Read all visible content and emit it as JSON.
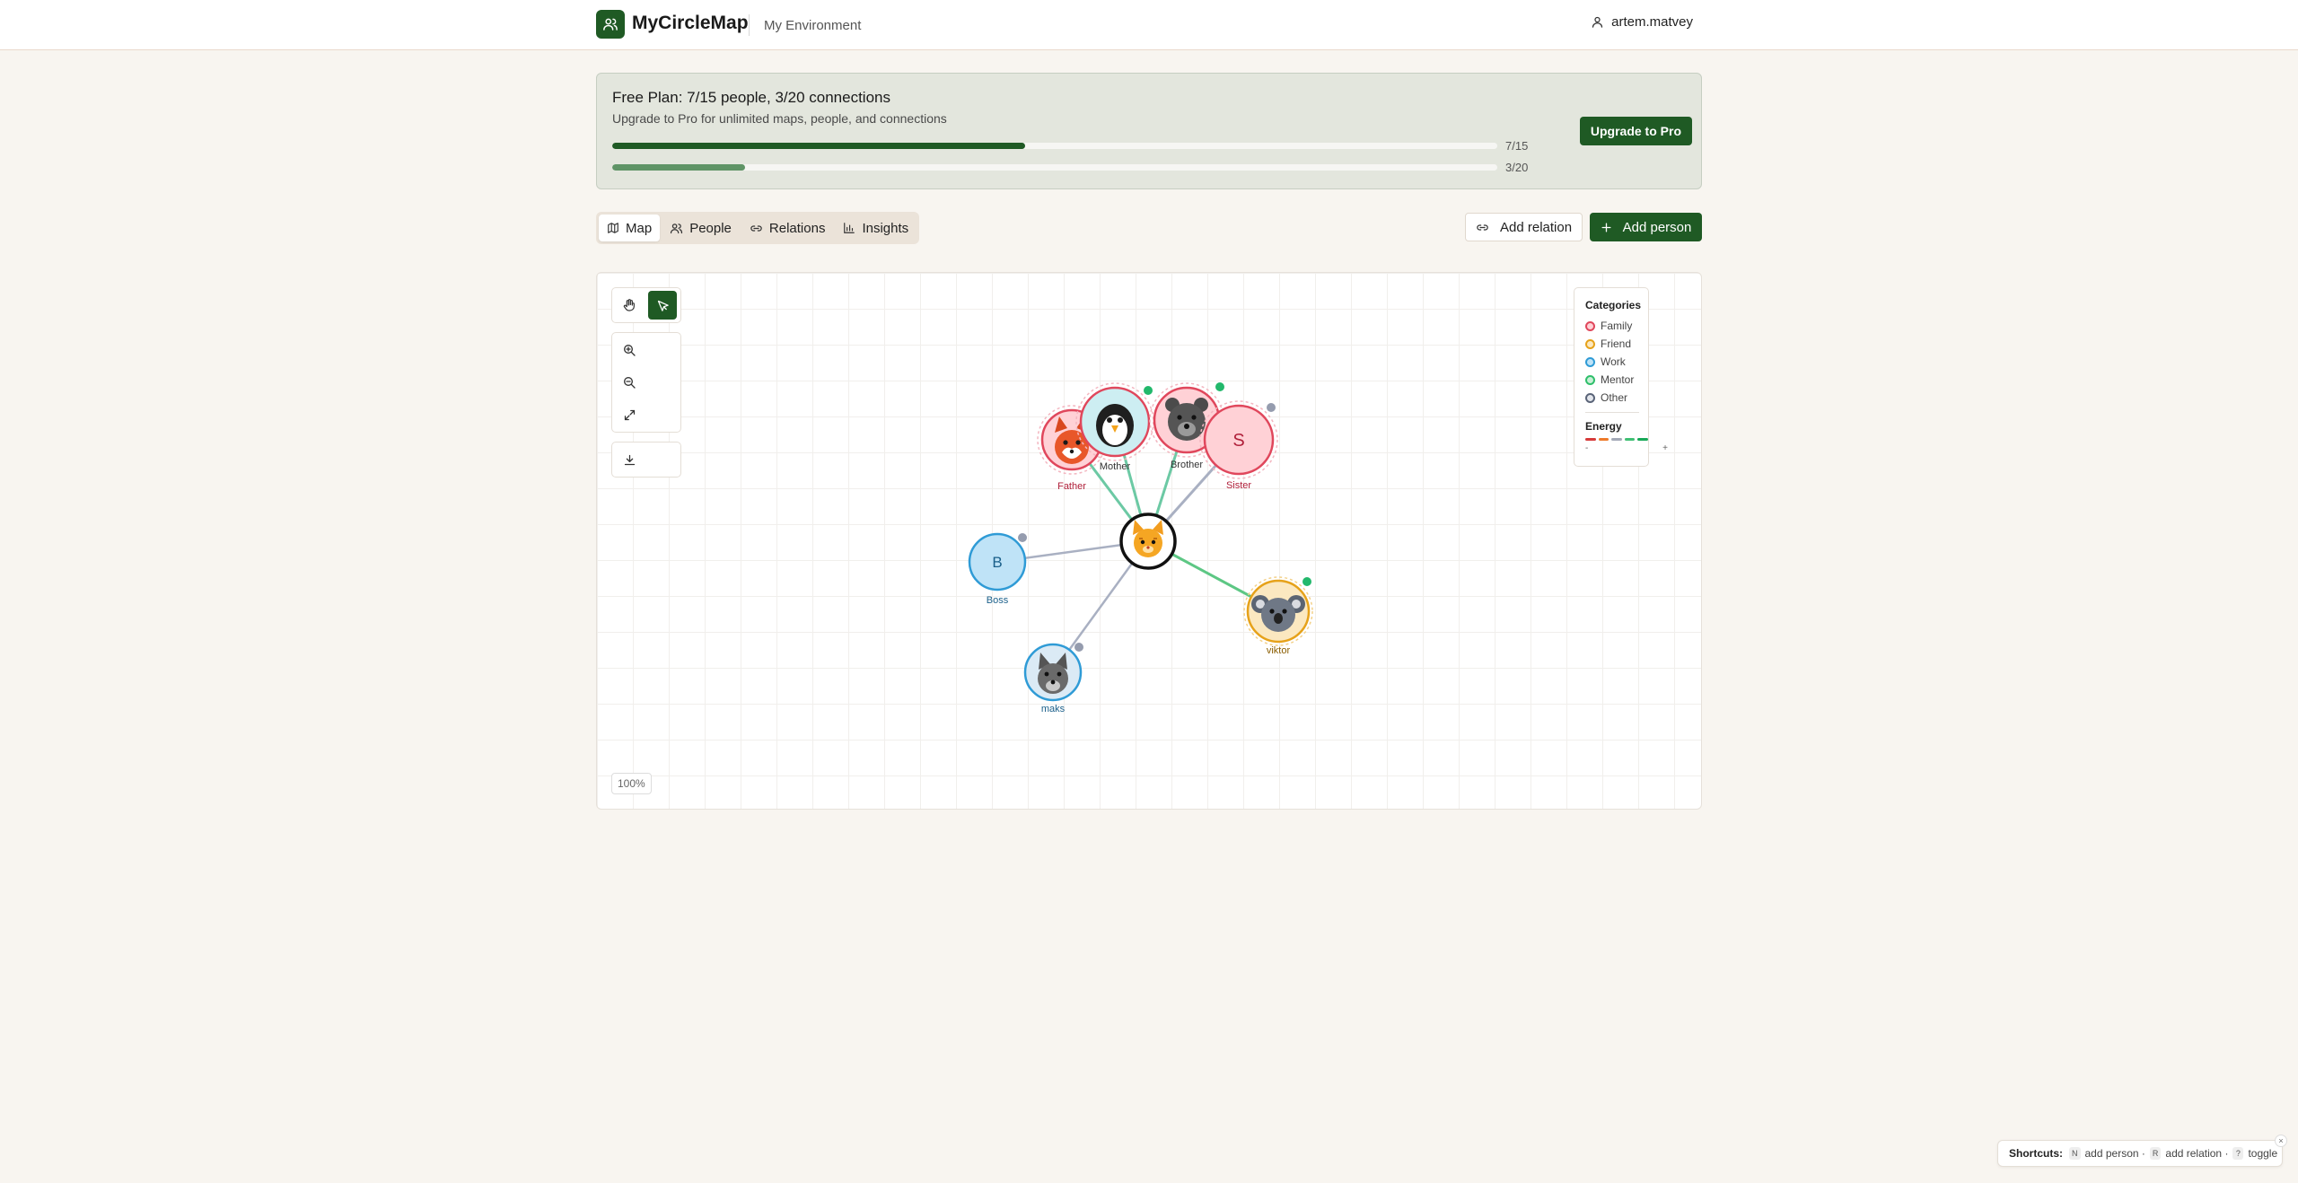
{
  "header": {
    "brand": "MyCircleMap",
    "environment": "My Environment",
    "username": "artem.matvey"
  },
  "plan": {
    "title": "Free Plan: 7/15 people, 3/20 connections",
    "subtitle": "Upgrade to Pro for unlimited maps, people, and connections",
    "people_label": "7/15",
    "people_progress": 0.467,
    "connections_label": "3/20",
    "connections_progress": 0.15,
    "upgrade_label": "Upgrade to Pro"
  },
  "tabs": [
    {
      "label": "Map",
      "icon": "map-icon",
      "active": true
    },
    {
      "label": "People",
      "icon": "users-icon",
      "active": false
    },
    {
      "label": "Relations",
      "icon": "link-icon",
      "active": false
    },
    {
      "label": "Insights",
      "icon": "bar-chart-icon",
      "active": false
    }
  ],
  "actions": {
    "add_relation": "Add relation",
    "add_person": "Add person"
  },
  "canvas": {
    "zoom_level": "100%"
  },
  "legend": {
    "categories_title": "Categories",
    "categories": [
      {
        "label": "Family",
        "color": "#e0475c"
      },
      {
        "label": "Friend",
        "color": "#e6a21a"
      },
      {
        "label": "Work",
        "color": "#2f9bd6"
      },
      {
        "label": "Mentor",
        "color": "#2fbf6b"
      },
      {
        "label": "Other",
        "color": "#5a6478"
      }
    ],
    "energy_title": "Energy",
    "energy_colors": [
      "#d63a3a",
      "#ee7a2b",
      "#a3a9b7",
      "#3fbf73",
      "#18a857"
    ],
    "energy_min": "-",
    "energy_max": "+"
  },
  "people": [
    {
      "name": "Father",
      "category": "Family",
      "avatar": "fox"
    },
    {
      "name": "Mother",
      "category": "Family",
      "avatar": "penguin"
    },
    {
      "name": "Brother",
      "category": "Family",
      "avatar": "bear"
    },
    {
      "name": "Sister",
      "category": "Family",
      "avatar": "S"
    },
    {
      "name": "Boss",
      "category": "Work",
      "avatar": "B"
    },
    {
      "name": "viktor",
      "category": "Friend",
      "avatar": "koala"
    },
    {
      "name": "maks",
      "category": "Work",
      "avatar": "wolf"
    }
  ],
  "shortcuts": {
    "title": "Shortcuts:",
    "items": [
      {
        "key": "N",
        "label": "add person ·"
      },
      {
        "key": "R",
        "label": "add relation ·"
      },
      {
        "key": "?",
        "label": "toggle"
      }
    ],
    "close": "×"
  }
}
